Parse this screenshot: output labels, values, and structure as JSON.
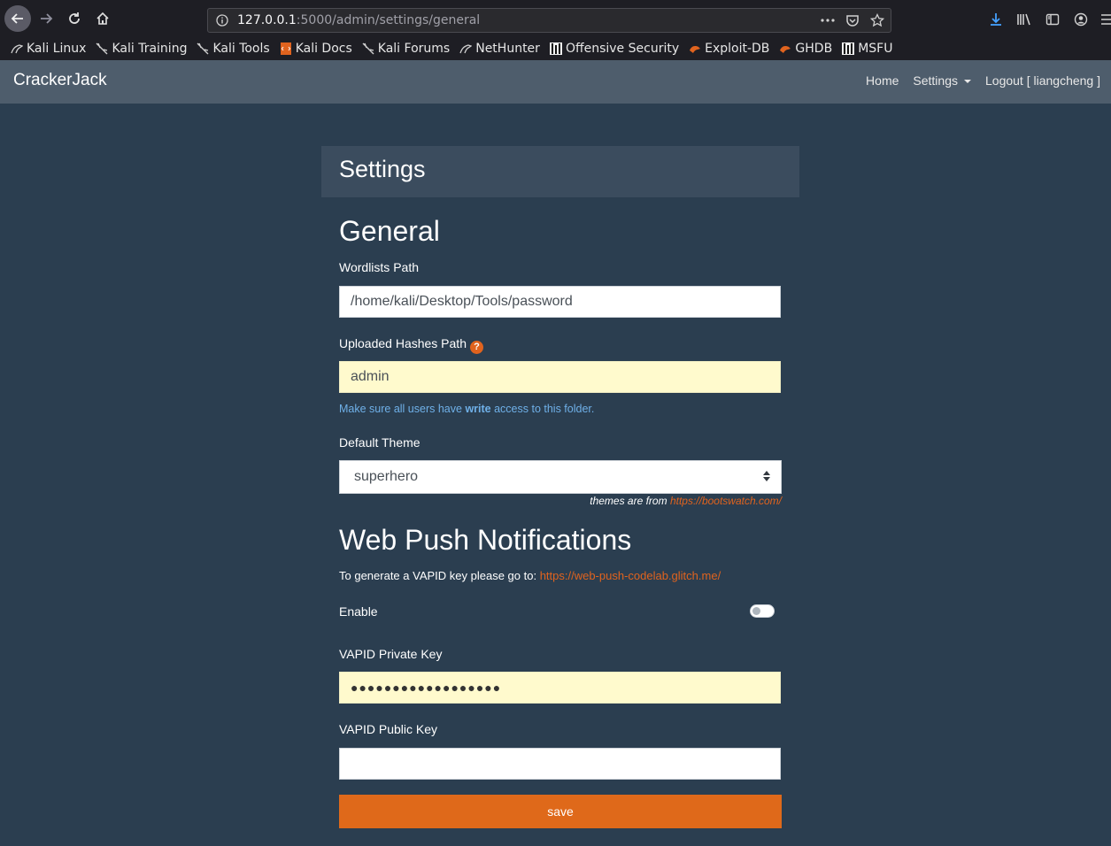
{
  "browser": {
    "url_host": "127.0.0.1",
    "url_path": ":5000/admin/settings/general",
    "bookmarks": [
      {
        "label": "Kali Linux",
        "icon": "kali-dragon-icon"
      },
      {
        "label": "Kali Training",
        "icon": "kali-dragon-icon"
      },
      {
        "label": "Kali Tools",
        "icon": "kali-dragon-icon"
      },
      {
        "label": "Kali Docs",
        "icon": "kali-docs-icon"
      },
      {
        "label": "Kali Forums",
        "icon": "kali-dragon-icon"
      },
      {
        "label": "NetHunter",
        "icon": "kali-dragon-icon"
      },
      {
        "label": "Offensive Security",
        "icon": "offsec-icon"
      },
      {
        "label": "Exploit-DB",
        "icon": "exploit-db-icon"
      },
      {
        "label": "GHDB",
        "icon": "ghdb-icon"
      },
      {
        "label": "MSFU",
        "icon": "offsec-icon"
      }
    ]
  },
  "navbar": {
    "brand": "CrackerJack",
    "home": "Home",
    "settings": "Settings",
    "logout": "Logout [ liangcheng ]"
  },
  "settings": {
    "title": "Settings",
    "general_heading": "General",
    "wordlists_label": "Wordlists Path",
    "wordlists_value": "/home/kali/Desktop/Tools/password",
    "hashes_label": "Uploaded Hashes Path",
    "hashes_value": "admin",
    "hashes_help_pre": "Make sure all users have ",
    "hashes_help_bold": "write",
    "hashes_help_post": " access to this folder.",
    "theme_label": "Default Theme",
    "theme_value": "superhero",
    "theme_note": "themes are from ",
    "theme_link": "https://bootswatch.com/",
    "push_heading": "Web Push Notifications",
    "vapid_note": "To generate a VAPID key please go to: ",
    "vapid_link": "https://web-push-codelab.glitch.me/",
    "enable_label": "Enable",
    "enable_on": false,
    "private_key_label": "VAPID Private Key",
    "private_key_value": "●●●●●●●●●●●●●●●●●●",
    "public_key_label": "VAPID Public Key",
    "public_key_value": "",
    "save_label": "save"
  },
  "colors": {
    "background": "#2b3e50",
    "navbar": "#4e5d6c",
    "accent": "#df691a",
    "help_text": "#6fb0e8"
  }
}
